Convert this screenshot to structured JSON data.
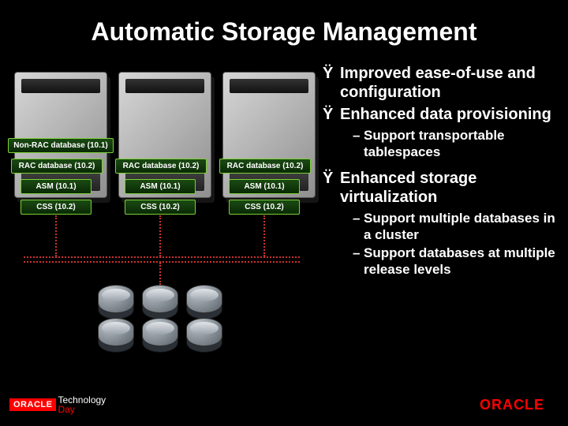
{
  "title": "Automatic Storage Management",
  "servers": {
    "non_rac_label": "Non-RAC database (10.1)",
    "rac_label": "RAC database (10.2)",
    "asm_label": "ASM (10.1)",
    "css_label": "CSS (10.2)"
  },
  "bullets": {
    "b1": "Improved ease-of-use and configuration",
    "b2": "Enhanced data provisioning",
    "b2_sub1": "Support transportable tablespaces",
    "b3": "Enhanced storage virtualization",
    "b3_sub1": "Support multiple databases in a cluster",
    "b3_sub2": "Support databases at multiple release levels"
  },
  "footer": {
    "oracle": "ORACLE",
    "tech": "Technology",
    "day": "Day",
    "right": "ORACLE"
  }
}
